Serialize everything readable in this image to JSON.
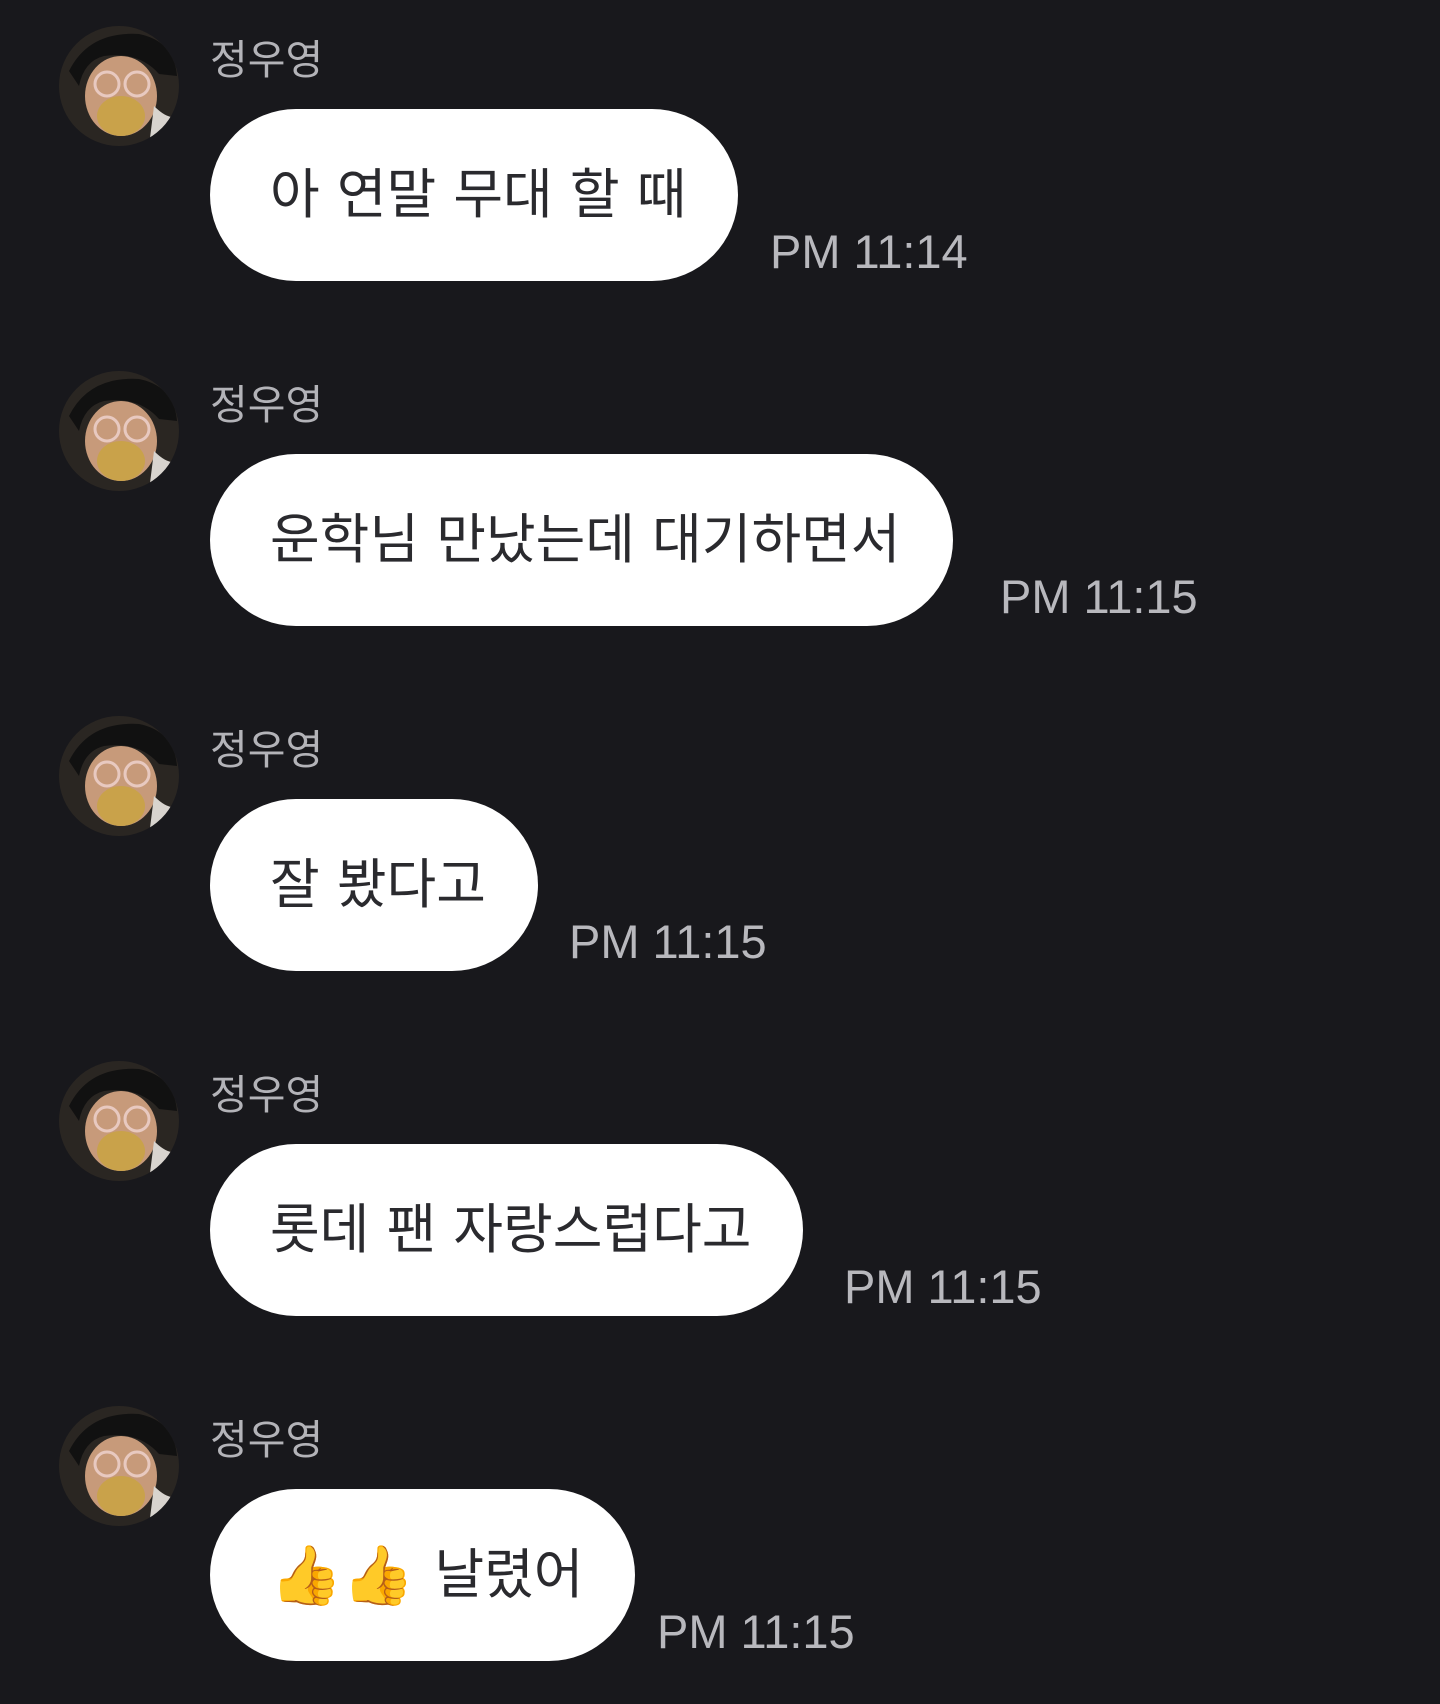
{
  "chat": {
    "messages": [
      {
        "sender": "정우영",
        "text": "아 연말 무대 할 때",
        "time": "PM 11:14"
      },
      {
        "sender": "정우영",
        "text": "운학님 만났는데 대기하면서",
        "time": "PM 11:15"
      },
      {
        "sender": "정우영",
        "text": "잘 봤다고",
        "time": "PM 11:15"
      },
      {
        "sender": "정우영",
        "text": "롯데 팬 자랑스럽다고",
        "time": "PM 11:15"
      },
      {
        "sender": "정우영",
        "emoji": "👍👍",
        "text": "날렸어",
        "time": "PM 11:15"
      }
    ]
  },
  "icons": {
    "avatar": "profile-photo-icon",
    "thumbs_up": "thumbs-up-icon"
  },
  "colors": {
    "background": "#18181c",
    "bubble": "#ffffff",
    "bubble_text": "#2a2a2e",
    "sender": "#b3b3b8",
    "time": "#b8b8bd"
  }
}
